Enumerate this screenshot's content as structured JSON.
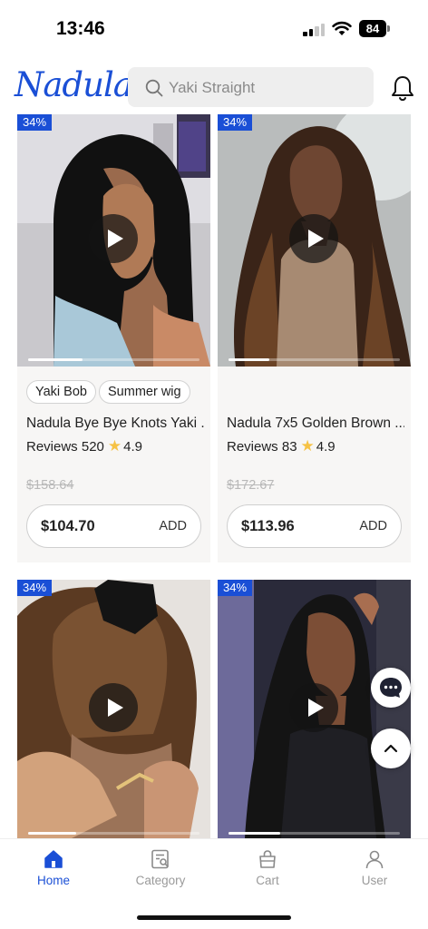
{
  "status_bar": {
    "time": "13:46",
    "battery": "84"
  },
  "header": {
    "logo": "Nadula",
    "search_placeholder": "Yaki Straight"
  },
  "products": [
    {
      "discount": "34%",
      "tags": [
        "Yaki Bob",
        "Summer wig"
      ],
      "title": "Nadula Bye Bye Knots Yaki ...",
      "reviews_label": "Reviews 520",
      "rating": "4.9",
      "old_price": "$158.64",
      "price": "$104.70",
      "add_label": "ADD"
    },
    {
      "discount": "34%",
      "tags": [],
      "title": "Nadula 7x5 Golden Brown ...",
      "reviews_label": "Reviews 83",
      "rating": "4.9",
      "old_price": "$172.67",
      "price": "$113.96",
      "add_label": "ADD"
    },
    {
      "discount": "34%"
    },
    {
      "discount": "34%"
    }
  ],
  "tabs": [
    {
      "label": "Home",
      "icon": "home-icon",
      "active": true
    },
    {
      "label": "Category",
      "icon": "category-icon",
      "active": false
    },
    {
      "label": "Cart",
      "icon": "cart-icon",
      "active": false
    },
    {
      "label": "User",
      "icon": "user-icon",
      "active": false
    }
  ],
  "colors": {
    "accent": "#1a4fd6",
    "star": "#f6c244"
  }
}
